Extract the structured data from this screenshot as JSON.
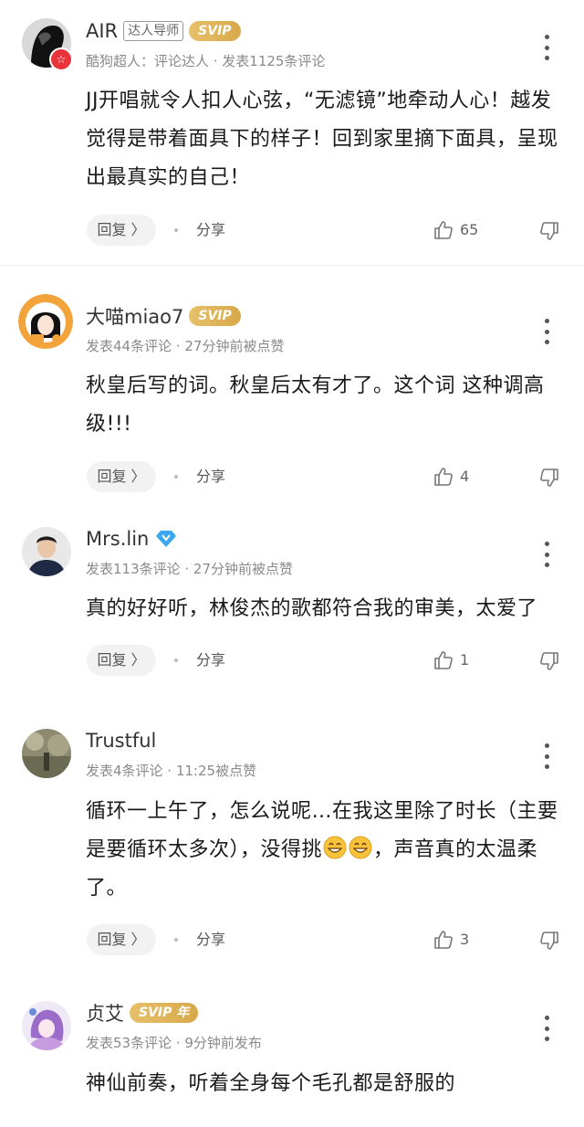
{
  "comments": [
    {
      "username": "AIR",
      "tag": "达人导师",
      "svip": "SVIP",
      "meta": "酷狗超人：评论达人 · 发表1125条评论",
      "content": "JJ开唱就令人扣人心弦，“无滤镜”地牵动人心！越发觉得是带着面具下的样子！回到家里摘下面具，呈现出最真实的自己！",
      "reply": "回复 〉",
      "share": "分享",
      "likes": "65"
    },
    {
      "username": "大喵miao7",
      "svip": "SVIP",
      "meta": "发表44条评论 · 27分钟前被点赞",
      "content": "秋皇后写的词。秋皇后太有才了。这个词 这种调高级!!!",
      "reply": "回复 〉",
      "share": "分享",
      "likes": "4"
    },
    {
      "username": "Mrs.lin",
      "meta": "发表113条评论 · 27分钟前被点赞",
      "content": "真的好好听，林俊杰的歌都符合我的审美，太爱了",
      "reply": "回复 〉",
      "share": "分享",
      "likes": "1"
    },
    {
      "username": "Trustful",
      "meta": "发表4条评论 · 11:25被点赞",
      "content_a": "循环一上午了，怎么说呢…在我这里除了时长（主要是要循环太多次），没得挑",
      "content_b": "，声音真的太温柔了。",
      "reply": "回复 〉",
      "share": "分享",
      "likes": "3"
    },
    {
      "username": "贞艾",
      "svip": "SVIP 年",
      "meta": "发表53条评论 · 9分钟前发布",
      "content": "神仙前奏，听着全身每个毛孔都是舒服的"
    }
  ],
  "colors": {
    "svip_gold": "#d8a94a",
    "badge_red": "#e8333a",
    "meta_gray": "#8a8a8a"
  },
  "icons": [
    "more-icon",
    "like-icon",
    "dislike-icon",
    "diamond-icon",
    "star-badge-icon",
    "grin-emoji-icon"
  ]
}
